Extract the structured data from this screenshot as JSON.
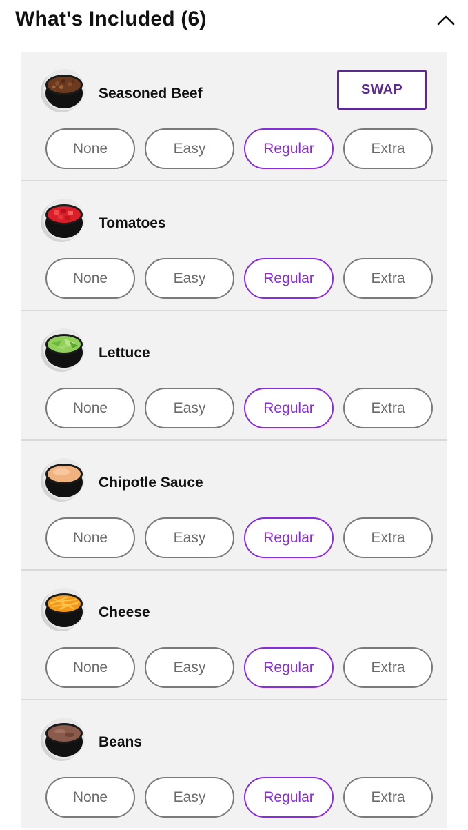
{
  "header": {
    "title": "What's Included (6)"
  },
  "accent": "#8a2be2",
  "swap_color": "#5b2a8f",
  "items": [
    {
      "name": "Seasoned Beef",
      "swap": "SWAP",
      "icon": "beef-cup-icon",
      "selected": "Regular"
    },
    {
      "name": "Tomatoes",
      "icon": "tomato-cup-icon",
      "selected": "Regular"
    },
    {
      "name": "Lettuce",
      "icon": "lettuce-cup-icon",
      "selected": "Regular"
    },
    {
      "name": "Chipotle Sauce",
      "icon": "sauce-cup-icon",
      "selected": "Regular"
    },
    {
      "name": "Cheese",
      "icon": "cheese-cup-icon",
      "selected": "Regular"
    },
    {
      "name": "Beans",
      "icon": "beans-cup-icon",
      "selected": "Regular"
    }
  ],
  "options": [
    "None",
    "Easy",
    "Regular",
    "Extra"
  ]
}
